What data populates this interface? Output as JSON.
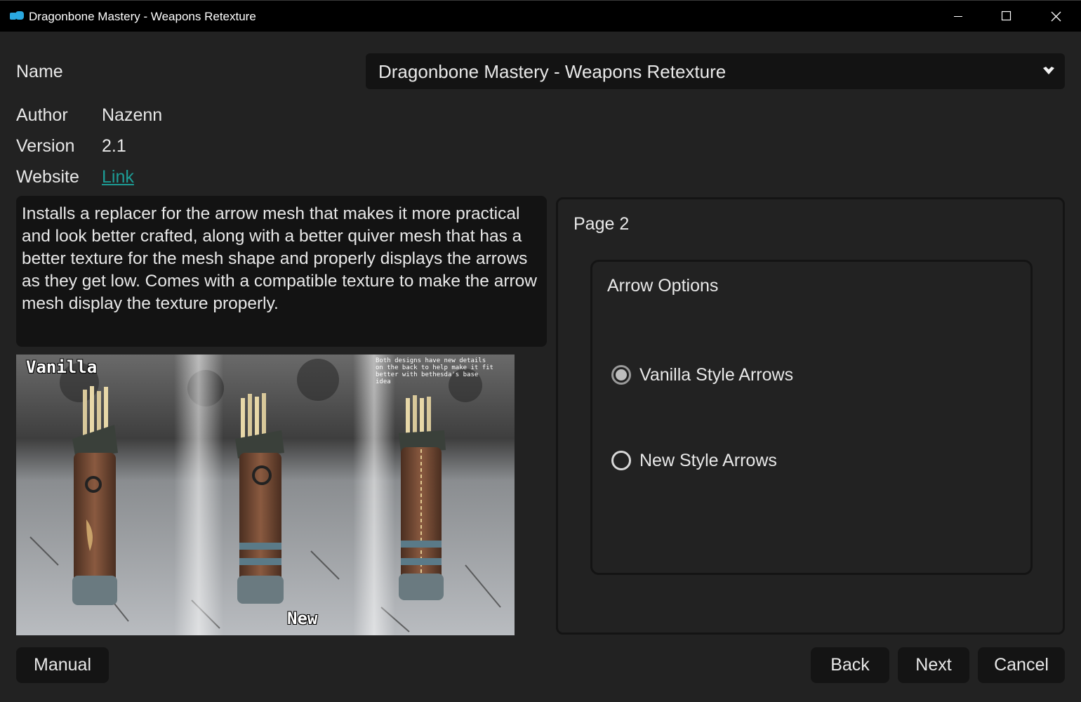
{
  "window": {
    "title": "Dragonbone Mastery - Weapons Retexture",
    "app_icon": "nexus-app-icon",
    "accent_color": "#2aa8e0"
  },
  "form": {
    "name_label": "Name",
    "name_value": "Dragonbone Mastery - Weapons Retexture",
    "author_label": "Author",
    "author_value": "Nazenn",
    "version_label": "Version",
    "version_value": "2.1",
    "website_label": "Website",
    "website_link": "Link",
    "link_color": "#1d9c95"
  },
  "description": "Installs a replacer for the arrow mesh that makes it more practical and look better crafted, along with a better quiver mesh that has a better texture for the mesh shape and properly displays the arrows as they get low. Comes with a compatible texture to make the arrow mesh display the texture properly.",
  "preview": {
    "label_vanilla": "Vanilla",
    "label_new": "New",
    "note": "Both designs have new details on the back to help make it fit better with bethesda's base idea"
  },
  "page": {
    "title": "Page 2",
    "group_title": "Arrow Options",
    "options": [
      {
        "label": "Vanilla Style Arrows",
        "selected": true
      },
      {
        "label": "New Style Arrows",
        "selected": false
      }
    ]
  },
  "buttons": {
    "manual": "Manual",
    "back": "Back",
    "next": "Next",
    "cancel": "Cancel"
  }
}
